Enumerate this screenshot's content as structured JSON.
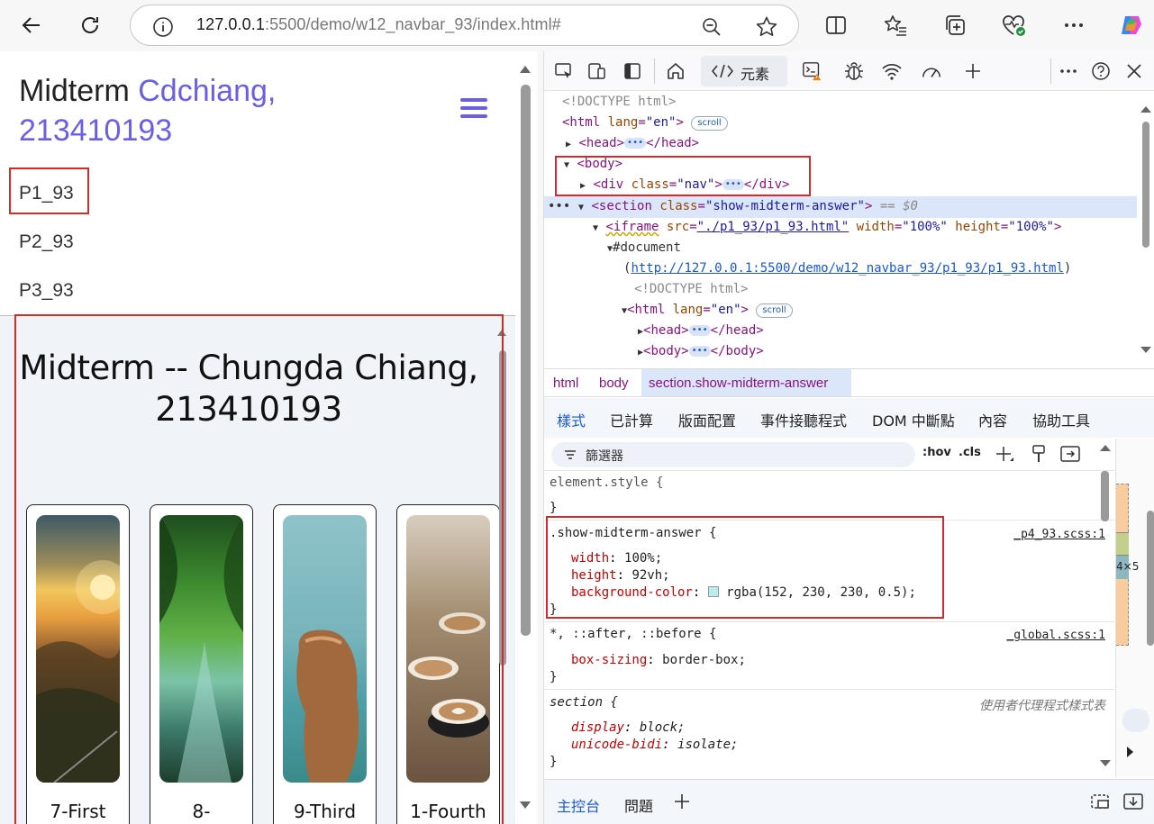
{
  "browser": {
    "url_host": "127.0.0.1",
    "url_rest": ":5500/demo/w12_navbar_93/index.html#"
  },
  "page": {
    "brand_prefix": "Midterm",
    "brand_name_line1": "Cdchiang,",
    "brand_name_line2": "213410193",
    "nav_links": [
      "P1_93",
      "P2_93",
      "P3_93"
    ],
    "section_title_line1": "Midterm -- Chungda Chiang,",
    "section_title_line2": "213410193",
    "cards": [
      "7-First",
      "8-",
      "9-Third",
      "1-Fourth"
    ]
  },
  "devtools": {
    "tab_elements": "元素",
    "dom": {
      "doctype": "<!DOCTYPE html>",
      "html_open": "<html",
      "lang_attr": "lang",
      "lang_val": "\"en\"",
      "scroll_badge": "scroll",
      "head_open": "<head>",
      "head_close": "</head>",
      "body_open": "<body>",
      "body_close": "</body>",
      "div_open": "<div",
      "class_attr": "class",
      "nav_val": "\"nav\"",
      "div_close": "</div>",
      "section_open": "<section",
      "section_class_val": "\"show-midterm-answer\"",
      "section_hint": "== $0",
      "iframe_open": "<iframe",
      "src_attr": "src",
      "src_val": "\"./p1_93/p1_93.html\"",
      "width_attr": "width",
      "width_val": "\"100%\"",
      "height_attr": "height",
      "height_val": "\"100%\"",
      "document": "#document",
      "doc_url": "http://127.0.0.1:5500/demo/w12_navbar_93/p1_93/p1_93.html"
    },
    "breadcrumbs": [
      "html",
      "body",
      "section.show-midterm-answer"
    ],
    "panel_tabs": [
      "樣式",
      "已計算",
      "版面配置",
      "事件接聽程式",
      "DOM 中斷點",
      "內容",
      "協助工具"
    ],
    "filter_placeholder": "篩選器",
    "hov": ":hov",
    "cls": ".cls",
    "styles": {
      "element_style": "element.style {",
      "close_brace": "}",
      "rule1_selector": ".show-midterm-answer {",
      "rule1_source": "_p4_93.scss:1",
      "rule1_props": [
        {
          "name": "width",
          "value": "100%;"
        },
        {
          "name": "height",
          "value": "92vh;"
        },
        {
          "name": "background-color",
          "value": "rgba(152, 230, 230, 0.5);"
        }
      ],
      "rule2_selector": "*, ::after, ::before {",
      "rule2_source": "_global.scss:1",
      "rule2_prop_name": "box-sizing",
      "rule2_prop_value": "border-box;",
      "rule3_selector": "section {",
      "rule3_source": "使用者代理程式樣式表",
      "rule3_props": [
        {
          "name": "display",
          "value": "block;"
        },
        {
          "name": "unicode-bidi",
          "value": "isolate;"
        }
      ]
    },
    "right_badge": "4×5",
    "drawer_tabs": [
      "主控台",
      "問題"
    ]
  },
  "colors": {
    "accent": "#6a5ee8",
    "highlight_red": "#d42a2a",
    "selection_bg": "#dbe6fb",
    "devtools_blue": "#1a58d6"
  }
}
